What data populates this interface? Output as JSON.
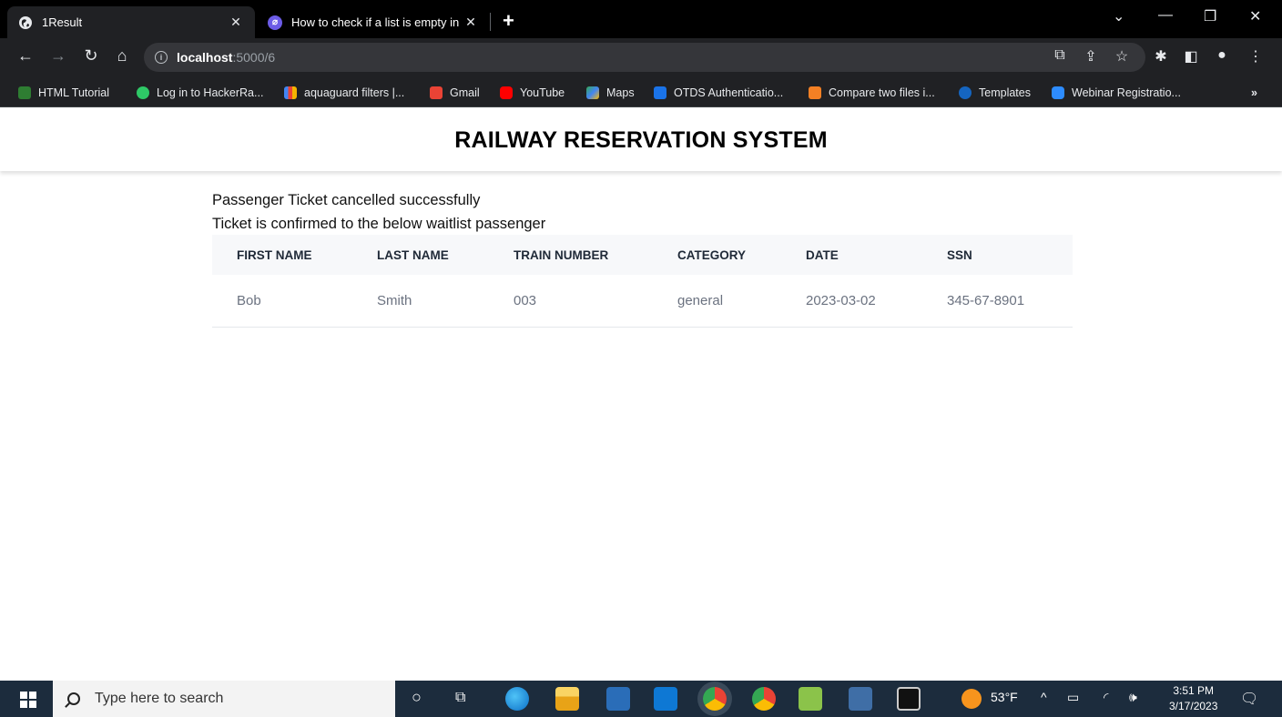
{
  "browser": {
    "tabs": [
      {
        "title": "1Result",
        "active": true
      },
      {
        "title": "How to check if a list is empty in",
        "active": false
      }
    ],
    "url_host": "localhost",
    "url_path": ":5000/6",
    "bookmarks": [
      {
        "label": "HTML Tutorial",
        "color": "#2e7d32"
      },
      {
        "label": "Log in to HackerRa...",
        "color": "#2ec866"
      },
      {
        "label": "aquaguard filters |...",
        "color": "#f4b400"
      },
      {
        "label": "Gmail",
        "color": "#ea4335"
      },
      {
        "label": "YouTube",
        "color": "#ff0000"
      },
      {
        "label": "Maps",
        "color": "#34a853"
      },
      {
        "label": "OTDS Authenticatio...",
        "color": "#1a73e8"
      },
      {
        "label": "Compare two files i...",
        "color": "#f48024"
      },
      {
        "label": "Templates",
        "color": "#1565c0"
      },
      {
        "label": "Webinar Registratio...",
        "color": "#2d8cff"
      }
    ],
    "bookmarks_overflow": "»"
  },
  "page": {
    "title": "RAILWAY RESERVATION SYSTEM",
    "message_1": "Passenger Ticket cancelled successfully",
    "message_2": "Ticket is confirmed to the below waitlist passenger",
    "table": {
      "headers": [
        "FIRST NAME",
        "LAST NAME",
        "TRAIN NUMBER",
        "CATEGORY",
        "DATE",
        "SSN"
      ],
      "rows": [
        [
          "Bob",
          "Smith",
          "003",
          "general",
          "2023-03-02",
          "345-67-8901"
        ]
      ]
    }
  },
  "taskbar": {
    "search_placeholder": "Type here to search",
    "temperature": "53°F",
    "time": "3:51 PM",
    "date": "3/17/2023"
  }
}
